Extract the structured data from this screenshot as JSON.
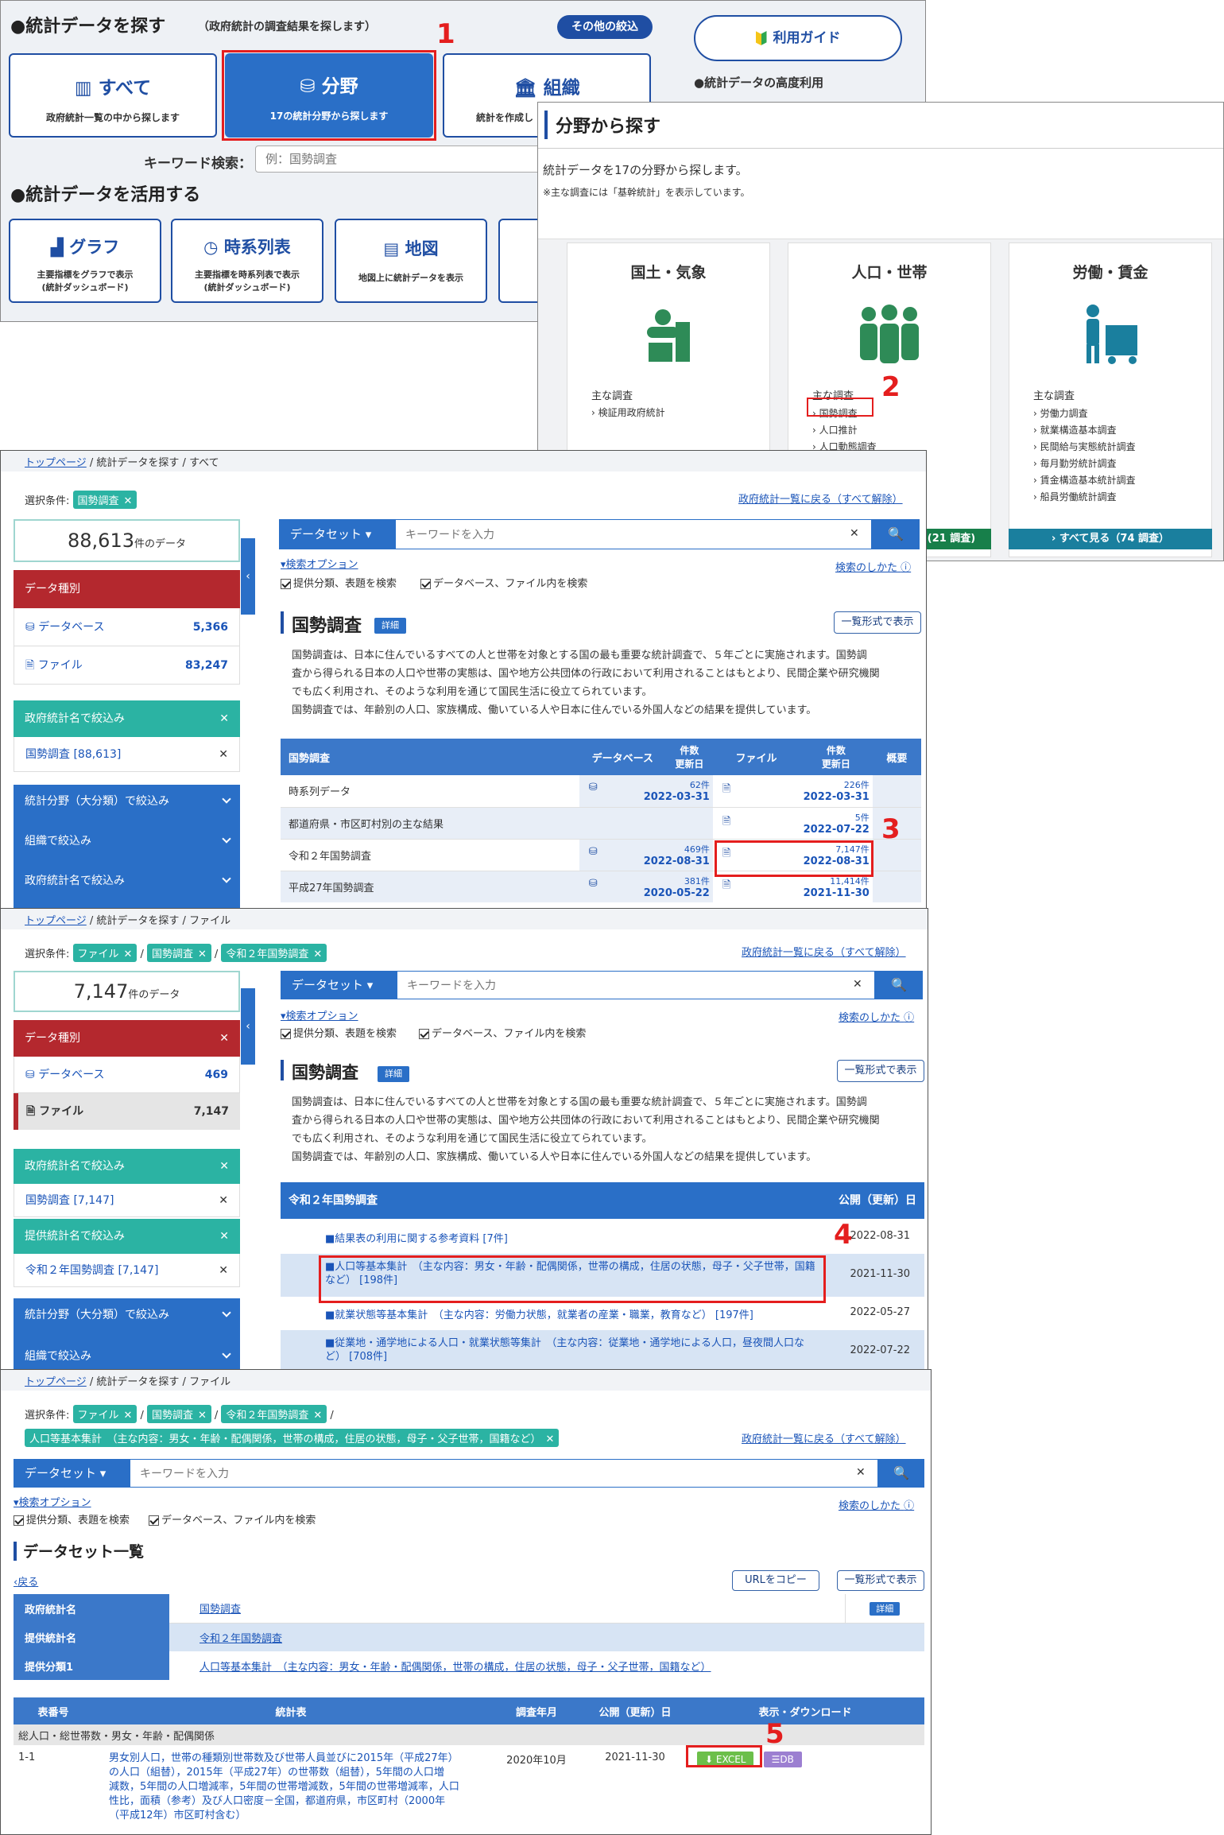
{
  "p1": {
    "find_title": "●統計データを探す",
    "find_sub": "（政府統計の調査結果を探します）",
    "other_btn": "その他の絞込",
    "guide_btn": "利用ガイド",
    "advanced": "●統計データの高度利用",
    "cards": [
      {
        "label": "すべて",
        "desc": "政府統計一覧の中から探します"
      },
      {
        "label": "分野",
        "desc": "17の統計分野から探します"
      },
      {
        "label": "組織",
        "desc": "統計を作成し"
      }
    ],
    "keyword_label": "キーワード検索：",
    "keyword_ph": "例：国勢調査",
    "use_title": "●統計データを活用する",
    "use_cards": [
      {
        "label": "グラフ",
        "desc1": "主要指標をグラフで表示",
        "desc2": "(統計ダッシュボード)"
      },
      {
        "label": "時系列表",
        "desc1": "主要指標を時系列表で表示",
        "desc2": "(統計ダッシュボード)"
      },
      {
        "label": "地図",
        "desc1": "地図上に統計データを表示",
        "desc2": ""
      }
    ]
  },
  "p2": {
    "title": "分野から探す",
    "desc": "統計データを17の分野から探します。",
    "note": "※主な調査には「基幹統計」を表示しています。",
    "main_label": "主な調査",
    "fields": [
      {
        "name": "国土・気象",
        "items": [
          "検証用政府統計"
        ],
        "color": "#2e8b57"
      },
      {
        "name": "人口・世帯",
        "items": [
          "国勢調査",
          "人口推計",
          "人口動態調査"
        ],
        "color": "#2e8b57"
      },
      {
        "name": "労働・賃金",
        "items": [
          "労働力調査",
          "就業構造基本調査",
          "民間給与実態統計調査",
          "毎月勤労統計調査",
          "賃金構造基本統計調査",
          "船員労働統計調査"
        ],
        "color": "#1a7f9e"
      }
    ],
    "see_all_mid": "(21 調査)",
    "see_all_right": "すべて見る（74 調査）"
  },
  "p3": {
    "breadcrumb": [
      "トップページ",
      "統計データを探す",
      "すべて"
    ],
    "cond_label": "選択条件:",
    "tags": [
      "国勢調査"
    ],
    "back_link": "政府統計一覧に戻る（すべて解除）",
    "count": "88,613",
    "count_unit": "件のデータ",
    "side": {
      "type_title": "データ種別",
      "db": "データベース",
      "db_n": "5,366",
      "file": "ファイル",
      "file_n": "83,247",
      "gov_title": "政府統計名で絞込み",
      "gov_item": "国勢調査 [88,613]",
      "f1": "統計分野（大分類）で絞込み",
      "f2": "組織で絞込み",
      "f3": "政府統計名で絞込み"
    },
    "dataset": "データセット",
    "kw_ph": "キーワードを入力",
    "opt": "検索オプション",
    "howto": "検索のしかた",
    "chk1": "提供分類、表題を検索",
    "chk2": "データベース、ファイル内を検索",
    "title": "国勢調査",
    "detail": "詳細",
    "list_btn": "一覧形式で表示",
    "text1": "国勢調査は、日本に住んでいるすべての人と世帯を対象とする国の最も重要な統計調査で、５年ごとに実施されます。国勢調",
    "text2": "査から得られる日本の人口や世帯の実態は、国や地方公共団体の行政において利用されることはもとより、民間企業や研究機関",
    "text3": "でも広く利用され、そのような利用を通じて国民生活に役立てられています。",
    "text4": "国勢調査では、年齢別の人口、家族構成、働いている人や日本に住んでいる外国人などの結果を提供しています。",
    "th": {
      "c1": "国勢調査",
      "c2": "データベース",
      "c3a": "件数",
      "c3b": "更新日",
      "c4": "ファイル",
      "c5a": "件数",
      "c5b": "更新日",
      "c6": "概要"
    },
    "rows": [
      {
        "name": "時系列データ",
        "dbn": "62件",
        "dbd": "2022-03-31",
        "fn": "226件",
        "fd": "2022-03-31",
        "db": true
      },
      {
        "name": "都道府県・市区町村別の主な結果",
        "dbn": "",
        "dbd": "",
        "fn": "5件",
        "fd": "2022-07-22",
        "db": false
      },
      {
        "name": "令和２年国勢調査",
        "dbn": "469件",
        "dbd": "2022-08-31",
        "fn": "7,147件",
        "fd": "2022-08-31",
        "db": true
      },
      {
        "name": "平成27年国勢調査",
        "dbn": "381件",
        "dbd": "2020-05-22",
        "fn": "11,414件",
        "fd": "2021-11-30",
        "db": true
      }
    ]
  },
  "p4": {
    "breadcrumb": [
      "トップページ",
      "統計データを探す",
      "ファイル"
    ],
    "tags": [
      "ファイル",
      "国勢調査",
      "令和２年国勢調査"
    ],
    "count": "7,147",
    "side": {
      "db_n": "469",
      "file_n": "7,147",
      "gov_item": "国勢調査 [7,147]",
      "prov_title": "提供統計名で絞込み",
      "prov_item": "令和２年国勢調査 [7,147]",
      "f1": "統計分野（大分類）で絞込み",
      "f2": "組織で絞込み"
    },
    "sub_title": "令和２年国勢調査",
    "pub_col": "公開（更新）日",
    "rows": [
      {
        "text": "■結果表の利用に関する参考資料 [7件]",
        "date": "2022-08-31"
      },
      {
        "text": "■人口等基本集計　（主な内容：男女・年齢・配偶関係，世帯の構成，住居の状態，母子・父子世帯，国籍など） [198件]",
        "date": "2021-11-30"
      },
      {
        "text": "■就業状態等基本集計　（主な内容：労働力状態，就業者の産業・職業，教育など） [197件]",
        "date": "2022-05-27"
      },
      {
        "text": "■従業地・通学地による人口・就業状態等集計　（主な内容：従業地・通学地による人口，昼夜間人口など） [708件]",
        "date": "2022-07-22"
      }
    ]
  },
  "p5": {
    "breadcrumb": [
      "トップページ",
      "統計データを探す",
      "ファイル"
    ],
    "tags": [
      "ファイル",
      "国勢調査",
      "令和２年国勢調査"
    ],
    "tag2": "人口等基本集計　（主な内容：男女・年齢・配偶関係，世帯の構成，住居の状態，母子・父子世帯，国籍など）",
    "list_title": "データセット一覧",
    "back": "戻る",
    "copy_url": "URLをコピー",
    "info": [
      {
        "k": "政府統計名",
        "v": "国勢調査"
      },
      {
        "k": "提供統計名",
        "v": "令和２年国勢調査"
      },
      {
        "k": "提供分類1",
        "v": "人口等基本集計　（主な内容：男女・年齢・配偶関係，世帯の構成，住居の状態，母子・父子世帯，国籍など）"
      }
    ],
    "th": {
      "c1": "表番号",
      "c2": "統計表",
      "c3": "調査年月",
      "c4": "公開（更新）日",
      "c5": "表示・ダウンロード"
    },
    "group": "総人口・総世帯数・男女・年齢・配偶関係",
    "row": {
      "no": "1-1",
      "l1": "男女別人口，世帯の種類別世帯数及び世帯人員並びに2015年（平成27年）",
      "l2": "の人口（組替），2015年（平成27年）の世帯数（組替），5年間の人口増",
      "l3": "減数，5年間の人口増減率，5年間の世帯増減数，5年間の世帯増減率，人口",
      "l4": "性比，面積（参考）及び人口密度－全国，都道府県，市区町村（2000年",
      "l5": "（平成12年）市区町村含む）",
      "ym": "2020年10月",
      "pub": "2021-11-30",
      "excel": "EXCEL",
      "db": "DB"
    }
  },
  "steps": [
    "1",
    "2",
    "3",
    "4",
    "5"
  ]
}
